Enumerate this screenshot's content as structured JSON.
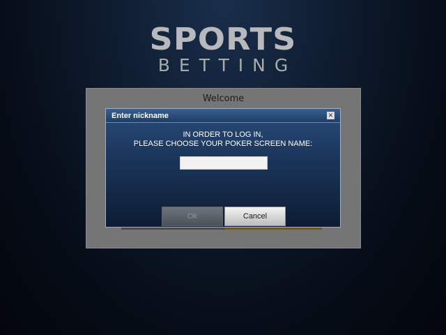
{
  "logo": {
    "line1": "SPORTS",
    "line2": "BETTING"
  },
  "welcome_panel": {
    "title": "Welcome"
  },
  "dialog": {
    "title": "Enter nickname",
    "close_glyph": "×",
    "message_line1": "IN ORDER TO LOG IN,",
    "message_line2": "PLEASE CHOOSE YOUR POKER SCREEN NAME:",
    "nickname_value": "",
    "ok_label": "Ok",
    "cancel_label": "Cancel",
    "ok_enabled": false
  },
  "colors": {
    "dialog_top": "#2a4d7a",
    "dialog_bottom": "#0d1c33",
    "panel": "#757575",
    "logo": "#b7b9bc"
  }
}
